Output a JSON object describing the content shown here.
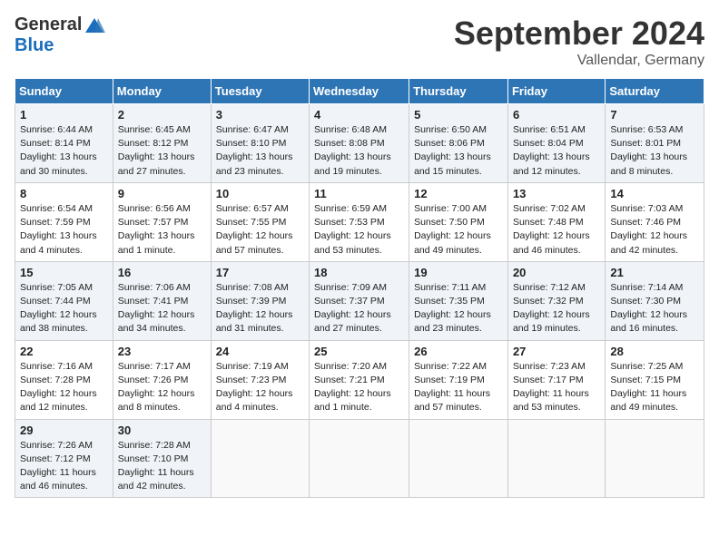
{
  "header": {
    "logo_general": "General",
    "logo_blue": "Blue",
    "month_title": "September 2024",
    "location": "Vallendar, Germany"
  },
  "days_of_week": [
    "Sunday",
    "Monday",
    "Tuesday",
    "Wednesday",
    "Thursday",
    "Friday",
    "Saturday"
  ],
  "weeks": [
    [
      {
        "day": 1,
        "info": "Sunrise: 6:44 AM\nSunset: 8:14 PM\nDaylight: 13 hours\nand 30 minutes."
      },
      {
        "day": 2,
        "info": "Sunrise: 6:45 AM\nSunset: 8:12 PM\nDaylight: 13 hours\nand 27 minutes."
      },
      {
        "day": 3,
        "info": "Sunrise: 6:47 AM\nSunset: 8:10 PM\nDaylight: 13 hours\nand 23 minutes."
      },
      {
        "day": 4,
        "info": "Sunrise: 6:48 AM\nSunset: 8:08 PM\nDaylight: 13 hours\nand 19 minutes."
      },
      {
        "day": 5,
        "info": "Sunrise: 6:50 AM\nSunset: 8:06 PM\nDaylight: 13 hours\nand 15 minutes."
      },
      {
        "day": 6,
        "info": "Sunrise: 6:51 AM\nSunset: 8:04 PM\nDaylight: 13 hours\nand 12 minutes."
      },
      {
        "day": 7,
        "info": "Sunrise: 6:53 AM\nSunset: 8:01 PM\nDaylight: 13 hours\nand 8 minutes."
      }
    ],
    [
      {
        "day": 8,
        "info": "Sunrise: 6:54 AM\nSunset: 7:59 PM\nDaylight: 13 hours\nand 4 minutes."
      },
      {
        "day": 9,
        "info": "Sunrise: 6:56 AM\nSunset: 7:57 PM\nDaylight: 13 hours\nand 1 minute."
      },
      {
        "day": 10,
        "info": "Sunrise: 6:57 AM\nSunset: 7:55 PM\nDaylight: 12 hours\nand 57 minutes."
      },
      {
        "day": 11,
        "info": "Sunrise: 6:59 AM\nSunset: 7:53 PM\nDaylight: 12 hours\nand 53 minutes."
      },
      {
        "day": 12,
        "info": "Sunrise: 7:00 AM\nSunset: 7:50 PM\nDaylight: 12 hours\nand 49 minutes."
      },
      {
        "day": 13,
        "info": "Sunrise: 7:02 AM\nSunset: 7:48 PM\nDaylight: 12 hours\nand 46 minutes."
      },
      {
        "day": 14,
        "info": "Sunrise: 7:03 AM\nSunset: 7:46 PM\nDaylight: 12 hours\nand 42 minutes."
      }
    ],
    [
      {
        "day": 15,
        "info": "Sunrise: 7:05 AM\nSunset: 7:44 PM\nDaylight: 12 hours\nand 38 minutes."
      },
      {
        "day": 16,
        "info": "Sunrise: 7:06 AM\nSunset: 7:41 PM\nDaylight: 12 hours\nand 34 minutes."
      },
      {
        "day": 17,
        "info": "Sunrise: 7:08 AM\nSunset: 7:39 PM\nDaylight: 12 hours\nand 31 minutes."
      },
      {
        "day": 18,
        "info": "Sunrise: 7:09 AM\nSunset: 7:37 PM\nDaylight: 12 hours\nand 27 minutes."
      },
      {
        "day": 19,
        "info": "Sunrise: 7:11 AM\nSunset: 7:35 PM\nDaylight: 12 hours\nand 23 minutes."
      },
      {
        "day": 20,
        "info": "Sunrise: 7:12 AM\nSunset: 7:32 PM\nDaylight: 12 hours\nand 19 minutes."
      },
      {
        "day": 21,
        "info": "Sunrise: 7:14 AM\nSunset: 7:30 PM\nDaylight: 12 hours\nand 16 minutes."
      }
    ],
    [
      {
        "day": 22,
        "info": "Sunrise: 7:16 AM\nSunset: 7:28 PM\nDaylight: 12 hours\nand 12 minutes."
      },
      {
        "day": 23,
        "info": "Sunrise: 7:17 AM\nSunset: 7:26 PM\nDaylight: 12 hours\nand 8 minutes."
      },
      {
        "day": 24,
        "info": "Sunrise: 7:19 AM\nSunset: 7:23 PM\nDaylight: 12 hours\nand 4 minutes."
      },
      {
        "day": 25,
        "info": "Sunrise: 7:20 AM\nSunset: 7:21 PM\nDaylight: 12 hours\nand 1 minute."
      },
      {
        "day": 26,
        "info": "Sunrise: 7:22 AM\nSunset: 7:19 PM\nDaylight: 11 hours\nand 57 minutes."
      },
      {
        "day": 27,
        "info": "Sunrise: 7:23 AM\nSunset: 7:17 PM\nDaylight: 11 hours\nand 53 minutes."
      },
      {
        "day": 28,
        "info": "Sunrise: 7:25 AM\nSunset: 7:15 PM\nDaylight: 11 hours\nand 49 minutes."
      }
    ],
    [
      {
        "day": 29,
        "info": "Sunrise: 7:26 AM\nSunset: 7:12 PM\nDaylight: 11 hours\nand 46 minutes."
      },
      {
        "day": 30,
        "info": "Sunrise: 7:28 AM\nSunset: 7:10 PM\nDaylight: 11 hours\nand 42 minutes."
      },
      null,
      null,
      null,
      null,
      null
    ]
  ]
}
